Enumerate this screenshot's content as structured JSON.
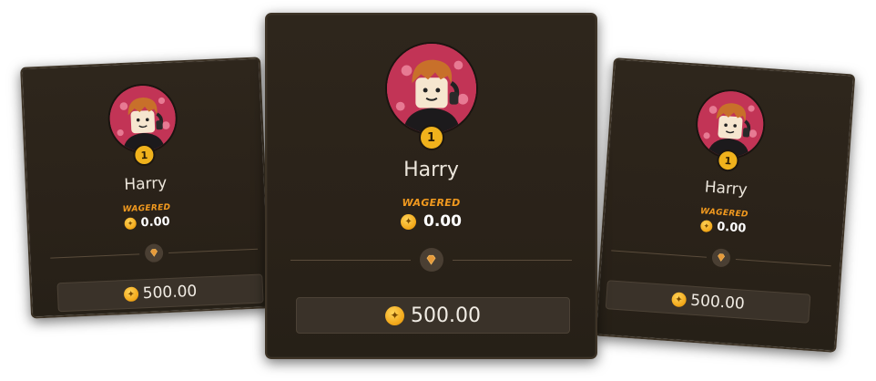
{
  "leaderboard": {
    "cards": [
      {
        "position": "left",
        "rank": "1",
        "name": "Harry",
        "wagered_label": "WAGERED",
        "wagered_value": "0.00",
        "prize": "500.00",
        "avatar_icon": "harry-avatar",
        "divider_icon": "diamond-icon"
      },
      {
        "position": "center",
        "rank": "1",
        "name": "Harry",
        "wagered_label": "WAGERED",
        "wagered_value": "0.00",
        "prize": "500.00",
        "avatar_icon": "harry-avatar",
        "divider_icon": "diamond-icon"
      },
      {
        "position": "right",
        "rank": "1",
        "name": "Harry",
        "wagered_label": "WAGERED",
        "wagered_value": "0.00",
        "prize": "500.00",
        "avatar_icon": "harry-avatar",
        "divider_icon": "diamond-icon"
      }
    ],
    "colors": {
      "card_bg": "#2a2219",
      "accent_orange": "#f29a1f",
      "coin_gold": "#f2a81a",
      "avatar_bg": "#c23456"
    }
  }
}
